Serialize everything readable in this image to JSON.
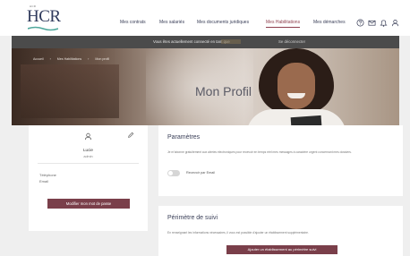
{
  "header": {
    "logo_small": "HCR",
    "logo_text": "HCR",
    "nav": [
      "Mes contrats",
      "Mes salariés",
      "Mes documents juridiques",
      "Mes Habilitations",
      "Mes démarches"
    ],
    "active_nav_index": 3,
    "icons": [
      "help-icon",
      "mail-icon",
      "bell-icon",
      "user-icon"
    ]
  },
  "banner": {
    "text": "Vous êtes actuellement connecté en tant que",
    "link": "Se déconnecter"
  },
  "hero": {
    "breadcrumb": [
      "Accueil",
      "Mes Habilitations",
      "Mon profil"
    ],
    "title": "Mon Profil"
  },
  "profile": {
    "name": "Lucie",
    "role": "admin",
    "phone_label": "Téléphone",
    "email_label": "Email",
    "change_password_label": "Modifier mon mot de passe"
  },
  "params": {
    "title": "Paramètres",
    "description": "Je m'abonne gratuitement aux alertes électroniques pour recevoir en temps réel mes messages à caractère urgent concernant mes dossiers.",
    "toggle_label": "Recevoir par Email",
    "toggle_on": false
  },
  "perimeter": {
    "title": "Périmètre de suivi",
    "description": "En renseignant les informations nécessaires, il vous est possible d'ajouter un établissement supplémentaire.",
    "button_label": "Ajouter un établissement au périmètre suivi"
  },
  "colors": {
    "accent": "#7a3f4a",
    "nav_text": "#3a3f58",
    "banner_bg": "#4b4b4b"
  }
}
